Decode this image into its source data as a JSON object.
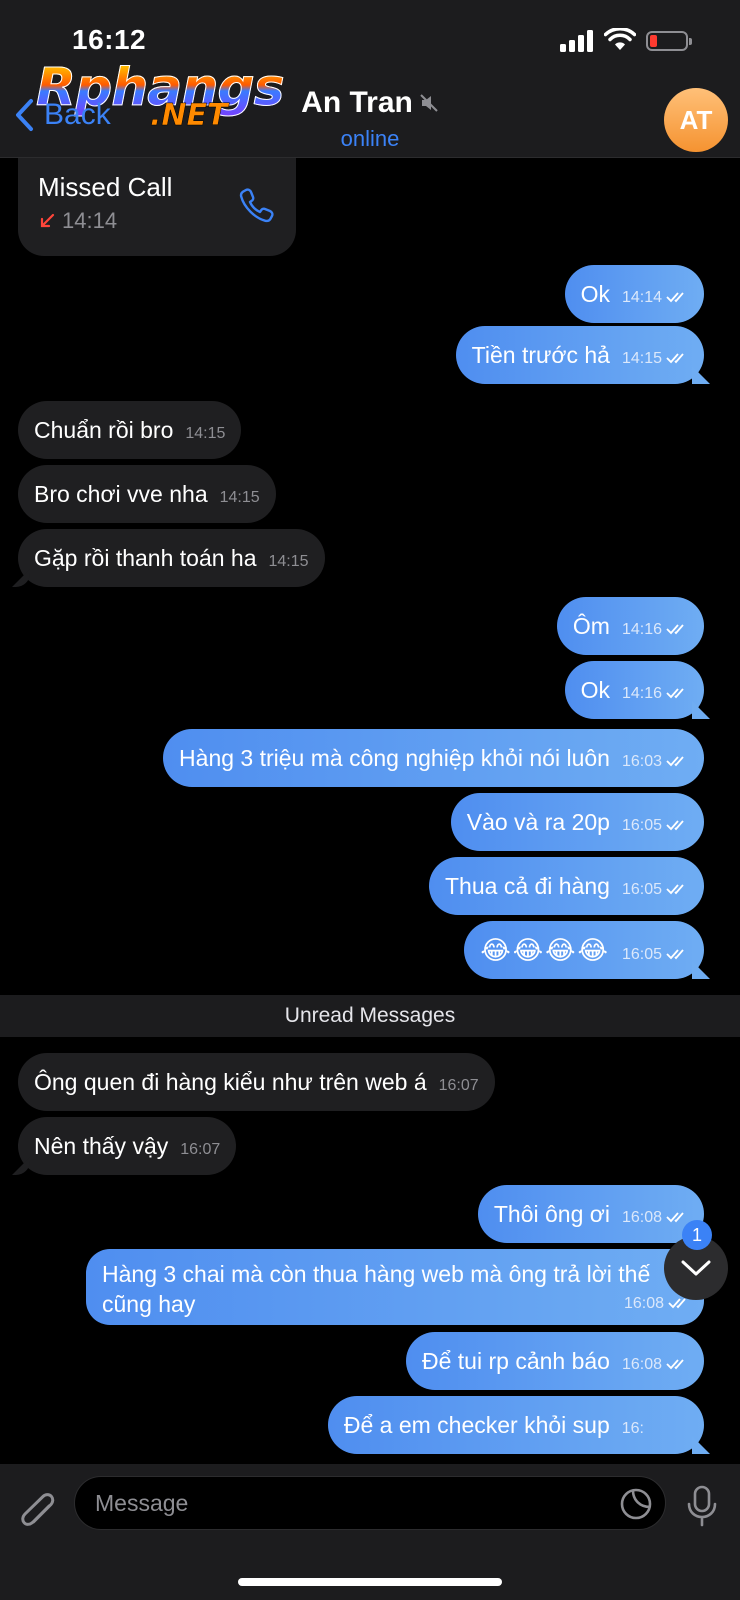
{
  "status_bar": {
    "time": "16:12"
  },
  "watermark": {
    "line1": "Rphangs",
    "line2": ".NET"
  },
  "nav": {
    "back_label": "Back",
    "contact_name": "An Tran",
    "contact_status": "online",
    "avatar_initials": "AT"
  },
  "missed_call": {
    "title": "Missed Call",
    "time": "14:14"
  },
  "messages": [
    {
      "dir": "out",
      "text": "Ok",
      "time": "14:14"
    },
    {
      "dir": "out",
      "text": "Tiền trước hả",
      "time": "14:15"
    },
    {
      "dir": "in",
      "text": "Chuẩn rồi bro",
      "time": "14:15"
    },
    {
      "dir": "in",
      "text": "Bro chơi vve nha",
      "time": "14:15"
    },
    {
      "dir": "in",
      "text": "Gặp rồi thanh toán ha",
      "time": "14:15"
    },
    {
      "dir": "out",
      "text": "Ôm",
      "time": "14:16"
    },
    {
      "dir": "out",
      "text": "Ok",
      "time": "14:16"
    },
    {
      "dir": "out",
      "text": "Hàng 3 triệu mà công nghiệp khỏi nói luôn",
      "time": "16:03"
    },
    {
      "dir": "out",
      "text": "Vào và ra 20p",
      "time": "16:05"
    },
    {
      "dir": "out",
      "text": "Thua cả đi hàng",
      "time": "16:05"
    },
    {
      "dir": "out",
      "text": "😂😂😂😂",
      "time": "16:05"
    },
    {
      "dir": "in",
      "text": "Ông quen đi hàng kiểu như trên web á",
      "time": "16:07"
    },
    {
      "dir": "in",
      "text": "Nên thấy vậy",
      "time": "16:07"
    },
    {
      "dir": "out",
      "text": "Thôi ông ơi",
      "time": "16:08"
    },
    {
      "dir": "out",
      "text": "Hàng 3 chai mà còn thua hàng web mà ông trả lời thế cũng hay",
      "time": "16:08"
    },
    {
      "dir": "out",
      "text": "Để tui rp cảnh báo",
      "time": "16:08"
    },
    {
      "dir": "out",
      "text": "Để a em checker khỏi sup",
      "time": "16:"
    }
  ],
  "divider_label": "Unread Messages",
  "unread_count": "1",
  "input": {
    "placeholder": "Message"
  },
  "colors": {
    "accent": "#3b82f6",
    "outgoing_bubble": "#5a9af1",
    "incoming_bubble": "#1f1f21",
    "avatar": "#f59331"
  }
}
